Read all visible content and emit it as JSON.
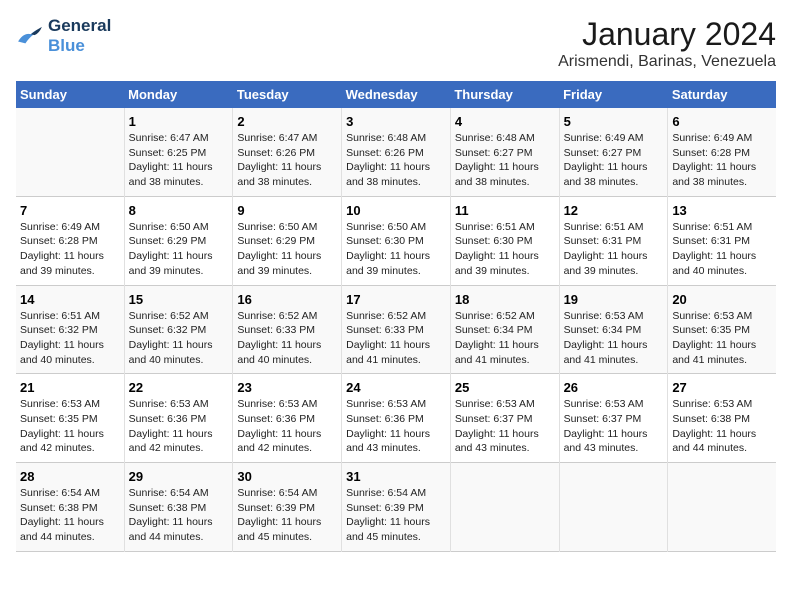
{
  "logo": {
    "line1": "General",
    "line2": "Blue"
  },
  "title": "January 2024",
  "subtitle": "Arismendi, Barinas, Venezuela",
  "days_header": [
    "Sunday",
    "Monday",
    "Tuesday",
    "Wednesday",
    "Thursday",
    "Friday",
    "Saturday"
  ],
  "weeks": [
    [
      {
        "num": "",
        "info": ""
      },
      {
        "num": "1",
        "info": "Sunrise: 6:47 AM\nSunset: 6:25 PM\nDaylight: 11 hours\nand 38 minutes."
      },
      {
        "num": "2",
        "info": "Sunrise: 6:47 AM\nSunset: 6:26 PM\nDaylight: 11 hours\nand 38 minutes."
      },
      {
        "num": "3",
        "info": "Sunrise: 6:48 AM\nSunset: 6:26 PM\nDaylight: 11 hours\nand 38 minutes."
      },
      {
        "num": "4",
        "info": "Sunrise: 6:48 AM\nSunset: 6:27 PM\nDaylight: 11 hours\nand 38 minutes."
      },
      {
        "num": "5",
        "info": "Sunrise: 6:49 AM\nSunset: 6:27 PM\nDaylight: 11 hours\nand 38 minutes."
      },
      {
        "num": "6",
        "info": "Sunrise: 6:49 AM\nSunset: 6:28 PM\nDaylight: 11 hours\nand 38 minutes."
      }
    ],
    [
      {
        "num": "7",
        "info": "Sunrise: 6:49 AM\nSunset: 6:28 PM\nDaylight: 11 hours\nand 39 minutes."
      },
      {
        "num": "8",
        "info": "Sunrise: 6:50 AM\nSunset: 6:29 PM\nDaylight: 11 hours\nand 39 minutes."
      },
      {
        "num": "9",
        "info": "Sunrise: 6:50 AM\nSunset: 6:29 PM\nDaylight: 11 hours\nand 39 minutes."
      },
      {
        "num": "10",
        "info": "Sunrise: 6:50 AM\nSunset: 6:30 PM\nDaylight: 11 hours\nand 39 minutes."
      },
      {
        "num": "11",
        "info": "Sunrise: 6:51 AM\nSunset: 6:30 PM\nDaylight: 11 hours\nand 39 minutes."
      },
      {
        "num": "12",
        "info": "Sunrise: 6:51 AM\nSunset: 6:31 PM\nDaylight: 11 hours\nand 39 minutes."
      },
      {
        "num": "13",
        "info": "Sunrise: 6:51 AM\nSunset: 6:31 PM\nDaylight: 11 hours\nand 40 minutes."
      }
    ],
    [
      {
        "num": "14",
        "info": "Sunrise: 6:51 AM\nSunset: 6:32 PM\nDaylight: 11 hours\nand 40 minutes."
      },
      {
        "num": "15",
        "info": "Sunrise: 6:52 AM\nSunset: 6:32 PM\nDaylight: 11 hours\nand 40 minutes."
      },
      {
        "num": "16",
        "info": "Sunrise: 6:52 AM\nSunset: 6:33 PM\nDaylight: 11 hours\nand 40 minutes."
      },
      {
        "num": "17",
        "info": "Sunrise: 6:52 AM\nSunset: 6:33 PM\nDaylight: 11 hours\nand 41 minutes."
      },
      {
        "num": "18",
        "info": "Sunrise: 6:52 AM\nSunset: 6:34 PM\nDaylight: 11 hours\nand 41 minutes."
      },
      {
        "num": "19",
        "info": "Sunrise: 6:53 AM\nSunset: 6:34 PM\nDaylight: 11 hours\nand 41 minutes."
      },
      {
        "num": "20",
        "info": "Sunrise: 6:53 AM\nSunset: 6:35 PM\nDaylight: 11 hours\nand 41 minutes."
      }
    ],
    [
      {
        "num": "21",
        "info": "Sunrise: 6:53 AM\nSunset: 6:35 PM\nDaylight: 11 hours\nand 42 minutes."
      },
      {
        "num": "22",
        "info": "Sunrise: 6:53 AM\nSunset: 6:36 PM\nDaylight: 11 hours\nand 42 minutes."
      },
      {
        "num": "23",
        "info": "Sunrise: 6:53 AM\nSunset: 6:36 PM\nDaylight: 11 hours\nand 42 minutes."
      },
      {
        "num": "24",
        "info": "Sunrise: 6:53 AM\nSunset: 6:36 PM\nDaylight: 11 hours\nand 43 minutes."
      },
      {
        "num": "25",
        "info": "Sunrise: 6:53 AM\nSunset: 6:37 PM\nDaylight: 11 hours\nand 43 minutes."
      },
      {
        "num": "26",
        "info": "Sunrise: 6:53 AM\nSunset: 6:37 PM\nDaylight: 11 hours\nand 43 minutes."
      },
      {
        "num": "27",
        "info": "Sunrise: 6:53 AM\nSunset: 6:38 PM\nDaylight: 11 hours\nand 44 minutes."
      }
    ],
    [
      {
        "num": "28",
        "info": "Sunrise: 6:54 AM\nSunset: 6:38 PM\nDaylight: 11 hours\nand 44 minutes."
      },
      {
        "num": "29",
        "info": "Sunrise: 6:54 AM\nSunset: 6:38 PM\nDaylight: 11 hours\nand 44 minutes."
      },
      {
        "num": "30",
        "info": "Sunrise: 6:54 AM\nSunset: 6:39 PM\nDaylight: 11 hours\nand 45 minutes."
      },
      {
        "num": "31",
        "info": "Sunrise: 6:54 AM\nSunset: 6:39 PM\nDaylight: 11 hours\nand 45 minutes."
      },
      {
        "num": "",
        "info": ""
      },
      {
        "num": "",
        "info": ""
      },
      {
        "num": "",
        "info": ""
      }
    ]
  ]
}
